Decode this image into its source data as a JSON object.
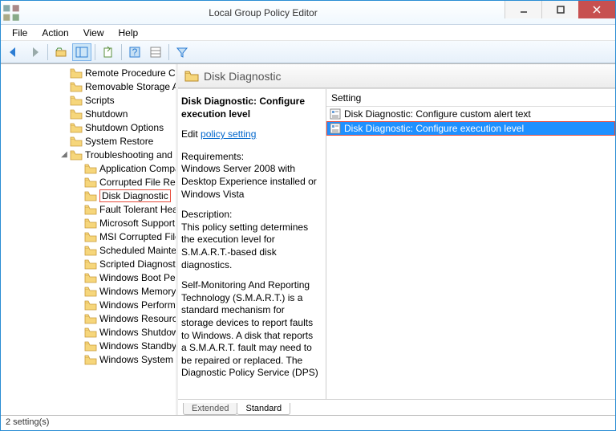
{
  "window": {
    "title": "Local Group Policy Editor"
  },
  "menu": [
    "File",
    "Action",
    "View",
    "Help"
  ],
  "tree": {
    "items": [
      {
        "indent": 4,
        "label": "Remote Procedure Cal"
      },
      {
        "indent": 4,
        "label": "Removable Storage Ac"
      },
      {
        "indent": 4,
        "label": "Scripts"
      },
      {
        "indent": 4,
        "label": "Shutdown"
      },
      {
        "indent": 4,
        "label": "Shutdown Options"
      },
      {
        "indent": 4,
        "label": "System Restore"
      },
      {
        "indent": 4,
        "label": "Troubleshooting and D",
        "expander": true
      },
      {
        "indent": 5,
        "label": "Application Compa"
      },
      {
        "indent": 5,
        "label": "Corrupted File Reco"
      },
      {
        "indent": 5,
        "label": "Disk Diagnostic",
        "highlight": true
      },
      {
        "indent": 5,
        "label": "Fault Tolerant Heap"
      },
      {
        "indent": 5,
        "label": "Microsoft Support"
      },
      {
        "indent": 5,
        "label": "MSI Corrupted File"
      },
      {
        "indent": 5,
        "label": "Scheduled Mainten"
      },
      {
        "indent": 5,
        "label": "Scripted Diagnostic"
      },
      {
        "indent": 5,
        "label": "Windows Boot Perf"
      },
      {
        "indent": 5,
        "label": "Windows Memory"
      },
      {
        "indent": 5,
        "label": "Windows Performa"
      },
      {
        "indent": 5,
        "label": "Windows Resource"
      },
      {
        "indent": 5,
        "label": "Windows Shutdow"
      },
      {
        "indent": 5,
        "label": "Windows Standby/"
      },
      {
        "indent": 5,
        "label": "Windows System R"
      }
    ]
  },
  "header": {
    "title": "Disk Diagnostic"
  },
  "desc": {
    "title": "Disk Diagnostic: Configure execution level",
    "edit_prefix": "Edit ",
    "edit_link": "policy setting ",
    "req_head": "Requirements:",
    "req_body": "Windows Server 2008 with Desktop Experience installed or Windows Vista",
    "desc_head": "Description:",
    "desc_body": "This policy setting determines the execution level for S.M.A.R.T.-based disk diagnostics.",
    "para2": "Self-Monitoring And Reporting Technology (S.M.A.R.T.) is a standard mechanism for storage devices to report faults to Windows. A disk that reports a S.M.A.R.T. fault may need to be repaired or replaced. The Diagnostic Policy Service (DPS)"
  },
  "list": {
    "column": "Setting",
    "rows": [
      {
        "label": "Disk Diagnostic: Configure custom alert text",
        "selected": false
      },
      {
        "label": "Disk Diagnostic: Configure execution level",
        "selected": true
      }
    ]
  },
  "tabs": {
    "extended": "Extended",
    "standard": "Standard"
  },
  "status": "2 setting(s)"
}
